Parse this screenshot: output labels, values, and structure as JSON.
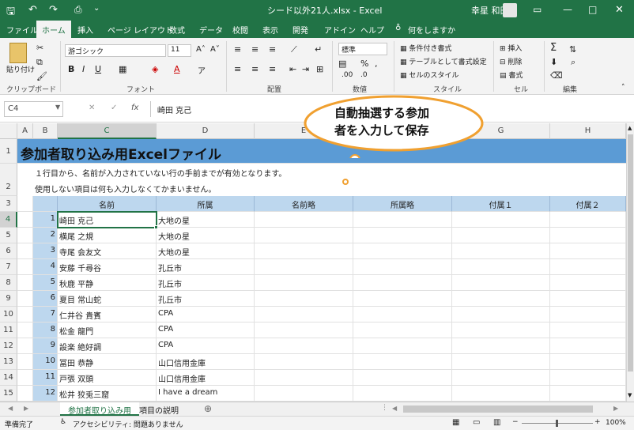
{
  "window": {
    "title": "シード以外21人.xlsx - Excel",
    "user": "幸星 和田"
  },
  "tabs": [
    "ファイル",
    "ホーム",
    "挿入",
    "ページ レイアウト",
    "数式",
    "データ",
    "校閲",
    "表示",
    "開発",
    "アドイン",
    "ヘルプ",
    "何をしますか"
  ],
  "ribbon": {
    "paste": "貼り付け",
    "clipboard": "クリップボード",
    "font_name": "游ゴシック",
    "font_size": "11",
    "font": "フォント",
    "alignment": "配置",
    "number_format": "標準",
    "number": "数値",
    "cond_format": "条件付き書式",
    "table_format": "テーブルとして書式設定",
    "cell_style": "セルのスタイル",
    "style": "スタイル",
    "insert": "挿入",
    "delete": "削除",
    "format": "書式",
    "cells": "セル",
    "edit": "編集"
  },
  "formula": {
    "name_box": "C4",
    "value": "崎田 克己",
    "fx": "fx"
  },
  "callout": {
    "line1": "自動抽選する参加",
    "line2": "者を入力して保存"
  },
  "columns": [
    "A",
    "B",
    "C",
    "D",
    "E",
    "F",
    "G",
    "H"
  ],
  "sheet": {
    "title": "参加者取り込み用Excelファイル",
    "note1": "１行目から、名前が入力されていない行の手前までが有効となります。",
    "note2": "使用しない項目は何も入力しなくてかまいません。",
    "headers": [
      "名前",
      "所属",
      "名前略",
      "所属略",
      "付属１",
      "付属２"
    ],
    "row_numbers": [
      "1",
      "2",
      "3",
      "4",
      "5",
      "6",
      "7",
      "8",
      "9",
      "10",
      "11",
      "12",
      "13",
      "14",
      "15"
    ],
    "rows": [
      {
        "n": "1",
        "name": "崎田 克己",
        "org": "大地の星"
      },
      {
        "n": "2",
        "name": "横尾 之規",
        "org": "大地の星"
      },
      {
        "n": "3",
        "name": "寺尾 会友文",
        "org": "大地の星"
      },
      {
        "n": "4",
        "name": "安藤 千尋谷",
        "org": "孔丘市"
      },
      {
        "n": "5",
        "name": "秋鹿 平静",
        "org": "孔丘市"
      },
      {
        "n": "6",
        "name": "夏目 常山蛇",
        "org": "孔丘市"
      },
      {
        "n": "7",
        "name": "仁井谷 貴賓",
        "org": "CPA"
      },
      {
        "n": "8",
        "name": "松金 龍門",
        "org": "CPA"
      },
      {
        "n": "9",
        "name": "設楽 絶好調",
        "org": "CPA"
      },
      {
        "n": "10",
        "name": "冨田 恭静",
        "org": "山口信用金庫"
      },
      {
        "n": "11",
        "name": "戸張 双頭",
        "org": "山口信用金庫"
      },
      {
        "n": "12",
        "name": "松井 狡兎三窟",
        "org": "I have a dream"
      }
    ]
  },
  "sheet_tabs": [
    "参加者取り込み用",
    "項目の説明"
  ],
  "status": {
    "ready": "準備完了",
    "accessibility": "アクセシビリティ: 問題ありません",
    "zoom": "100%"
  },
  "colors": {
    "brand": "#217346",
    "header_fill": "#5b9bd5",
    "table_fill": "#bdd7ee"
  }
}
